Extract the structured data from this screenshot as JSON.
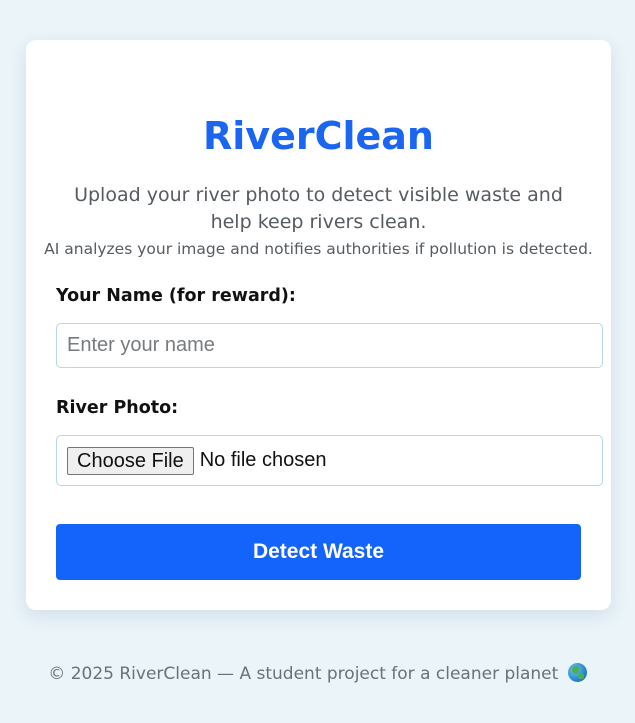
{
  "header": {
    "title": "RiverClean",
    "subtitle": "Upload your river photo to detect visible waste and help keep rivers clean.",
    "note": "AI analyzes your image and notifies authorities if pollution is detected."
  },
  "form": {
    "name_label": "Your Name (for reward):",
    "name_placeholder": "Enter your name",
    "name_value": "",
    "photo_label": "River Photo:",
    "file_button_label": "Choose File",
    "file_status": "No file chosen",
    "submit_label": "Detect Waste"
  },
  "footer": {
    "text": "© 2025 RiverClean — A student project for a cleaner planet",
    "icon": "globe-icon"
  },
  "colors": {
    "accent": "#1463fa",
    "title": "#1a66f0",
    "background": "#eaf4f9",
    "card": "#ffffff"
  }
}
